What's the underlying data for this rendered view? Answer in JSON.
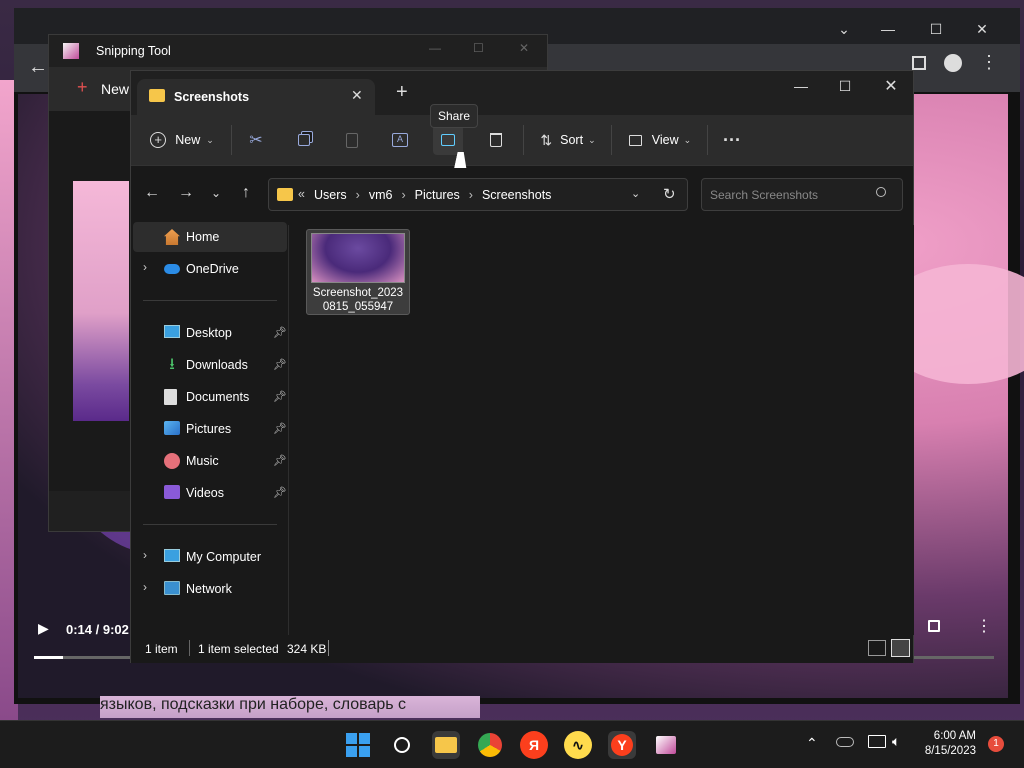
{
  "snipping_tool": {
    "title": "Snipping Tool",
    "new_label": "New"
  },
  "explorer": {
    "tab_title": "Screenshots",
    "tooltip": "Share",
    "cmd": {
      "new_label": "New",
      "sort_label": "Sort",
      "view_label": "View"
    },
    "breadcrumb": {
      "overflow": "«",
      "items": [
        "Users",
        "vm6",
        "Pictures",
        "Screenshots"
      ]
    },
    "search_placeholder": "Search Screenshots",
    "sidebar": {
      "home": "Home",
      "onedrive": "OneDrive",
      "desktop": "Desktop",
      "downloads": "Downloads",
      "documents": "Documents",
      "pictures": "Pictures",
      "music": "Music",
      "videos": "Videos",
      "my_computer": "My Computer",
      "network": "Network"
    },
    "file": {
      "name_line1": "Screenshot_2023",
      "name_line2": "0815_055947"
    },
    "status": {
      "count": "1 item",
      "selected": "1 item selected",
      "size": "324 KB"
    }
  },
  "video": {
    "time": "0:14 / 9:02",
    "caption": "языков, подсказки при наборе, словарь с"
  },
  "taskbar": {
    "time": "6:00 AM",
    "date": "8/15/2023",
    "notifications": "1",
    "yandex_letter": "Я",
    "yabrowser_letter": "Y"
  },
  "colors": {
    "accent": "#60cdff",
    "folder": "#f6c64a",
    "badge": "#e74c3c"
  }
}
